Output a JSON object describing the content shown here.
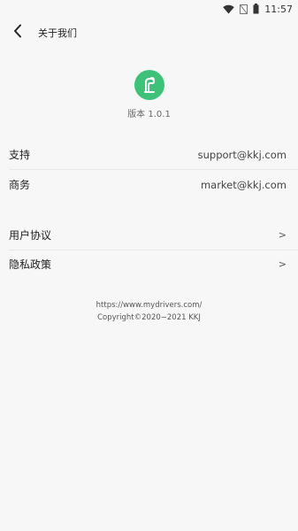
{
  "status_bar": {
    "time": "11:57",
    "icons": [
      "wifi-icon",
      "signal-off-icon",
      "battery-icon"
    ]
  },
  "header": {
    "back_icon": "chevron-left-icon",
    "title": "关于我们"
  },
  "app": {
    "logo_icon": "app-logo-icon",
    "logo_color": "#3ec27a",
    "version": "版本 1.0.1"
  },
  "contacts": [
    {
      "label": "支持",
      "value": "support@kkj.com"
    },
    {
      "label": "商务",
      "value": "market@kkj.com"
    }
  ],
  "links": [
    {
      "label": "用户协议",
      "chevron": ">"
    },
    {
      "label": "隐私政策",
      "chevron": ">"
    }
  ],
  "footer": {
    "url": "https://www.mydrivers.com/",
    "copyright": "Copyright©2020−2021 KKJ"
  }
}
